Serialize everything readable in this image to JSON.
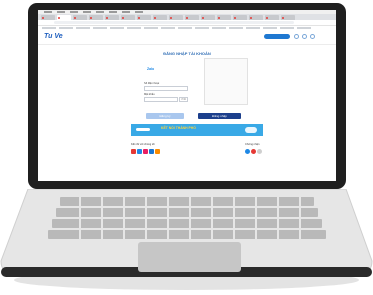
{
  "header": {
    "logo_text": "Tu Ve",
    "login_pill": "",
    "accent_color": "#1f5fbf"
  },
  "page": {
    "breadcrumb": "",
    "title": "ĐĂNG NHẬP TÀI KHOẢN"
  },
  "form": {
    "zalo_label": "Zalo",
    "phone_label": "Số điện thoại",
    "phone_placeholder": "",
    "password_label": "Mật khẩu",
    "password_placeholder": "",
    "country_select": "VNĐ",
    "btn_register": "Đăng ký",
    "btn_login": "Đăng nhập"
  },
  "banner": {
    "headline": "KẾT NỐI THÀNH PHỐ",
    "subline": "",
    "color": "#39a9e6"
  },
  "footer": {
    "left_title": "Kết nối với chúng tôi",
    "middle_text": "",
    "right_title": "Chứng nhận",
    "social_colors": [
      "#e53935",
      "#1e88e5",
      "#e91e63",
      "#1976d2",
      "#fb8c00"
    ]
  },
  "icons": {
    "user": "user-icon",
    "cart": "cart-icon",
    "menu": "menu-icon"
  }
}
